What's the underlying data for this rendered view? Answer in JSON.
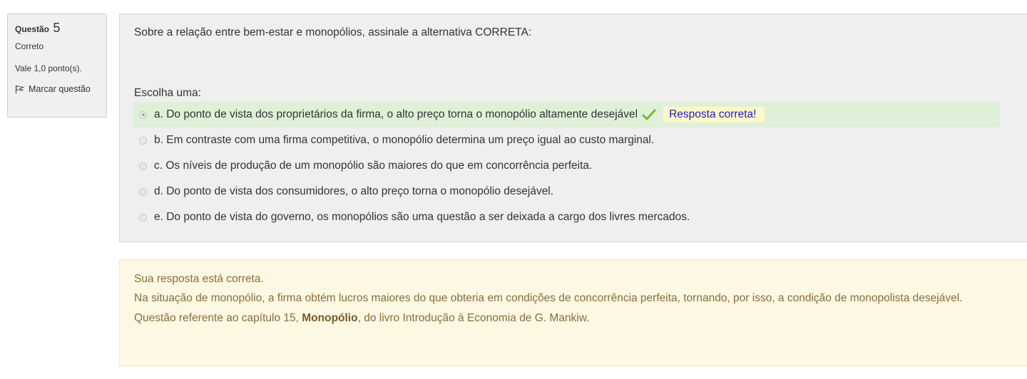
{
  "info": {
    "question_label": "Questão",
    "question_number": "5",
    "state": "Correto",
    "grade": "Vale 1,0 ponto(s).",
    "flag_label": "Marcar questão",
    "flag_icon": "flag-icon"
  },
  "question": {
    "text": "Sobre a relação entre bem-estar e monopólios, assinale a alternativa CORRETA:",
    "prompt": "Escolha uma:",
    "options": [
      {
        "label": "a. Do ponto de vista dos proprietários da firma, o alto preço torna o monopólio altamente desejável",
        "selected": true,
        "correct": true
      },
      {
        "label": "b. Em contraste com uma firma competitiva, o monopólio determina um preço igual ao custo marginal.",
        "selected": false
      },
      {
        "label": "c. Os níveis de produção de um monopólio são maiores do que em concorrência perfeita.",
        "selected": false
      },
      {
        "label": "d. Do ponto de vista dos consumidores, o alto preço torna o monopólio desejável.",
        "selected": false
      },
      {
        "label": "e. Do ponto de vista do governo, os monopólios são uma questão a ser deixada a cargo dos livres mercados.",
        "selected": false
      }
    ],
    "correct_feedback": "Resposta correta!",
    "check_icon": "checkmark-icon"
  },
  "outcome": {
    "status": "Sua resposta está correta.",
    "explanation": "Na situação de monopólio, a firma obtém lucros maiores do que obteria em condições de concorrência perfeita, tornando, por isso, a condição de monopolista desejável.",
    "reference_before": "Questão referente ao capítulo 15, ",
    "reference_bold": "Monopólio",
    "reference_after": ", do livro Introdução à Economia de G. Mankiw."
  },
  "colors": {
    "correct_bg": "#dff0d8",
    "feedback_bg": "#fcf8c9",
    "feedback_text": "#1f1fbf",
    "outcome_bg": "#fcf8e3",
    "outcome_text": "#8a6d3b",
    "check_green": "#6fbf3a"
  }
}
